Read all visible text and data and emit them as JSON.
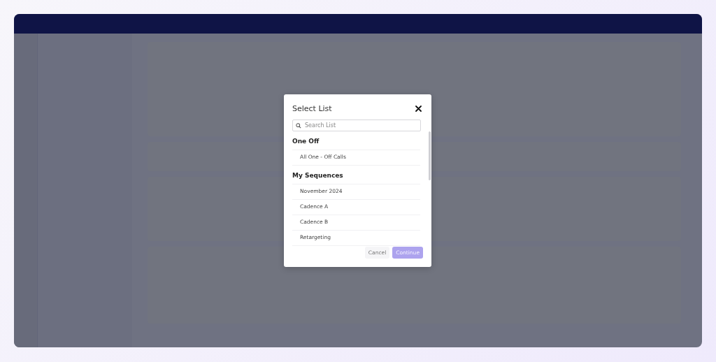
{
  "dialog": {
    "title": "Select List",
    "search": {
      "placeholder": "Search List"
    },
    "sections": [
      {
        "heading": "One Off",
        "items": [
          {
            "label": "All One - Off Calls"
          }
        ]
      },
      {
        "heading": "My Sequences",
        "items": [
          {
            "label": "November 2024"
          },
          {
            "label": "Cadence A"
          },
          {
            "label": "Cadence B"
          },
          {
            "label": "Retargeting"
          }
        ]
      }
    ],
    "buttons": [
      {
        "label": "Cancel",
        "kind": "secondary",
        "disabled": false
      },
      {
        "label": "Continue",
        "kind": "primary",
        "disabled": true
      }
    ]
  }
}
